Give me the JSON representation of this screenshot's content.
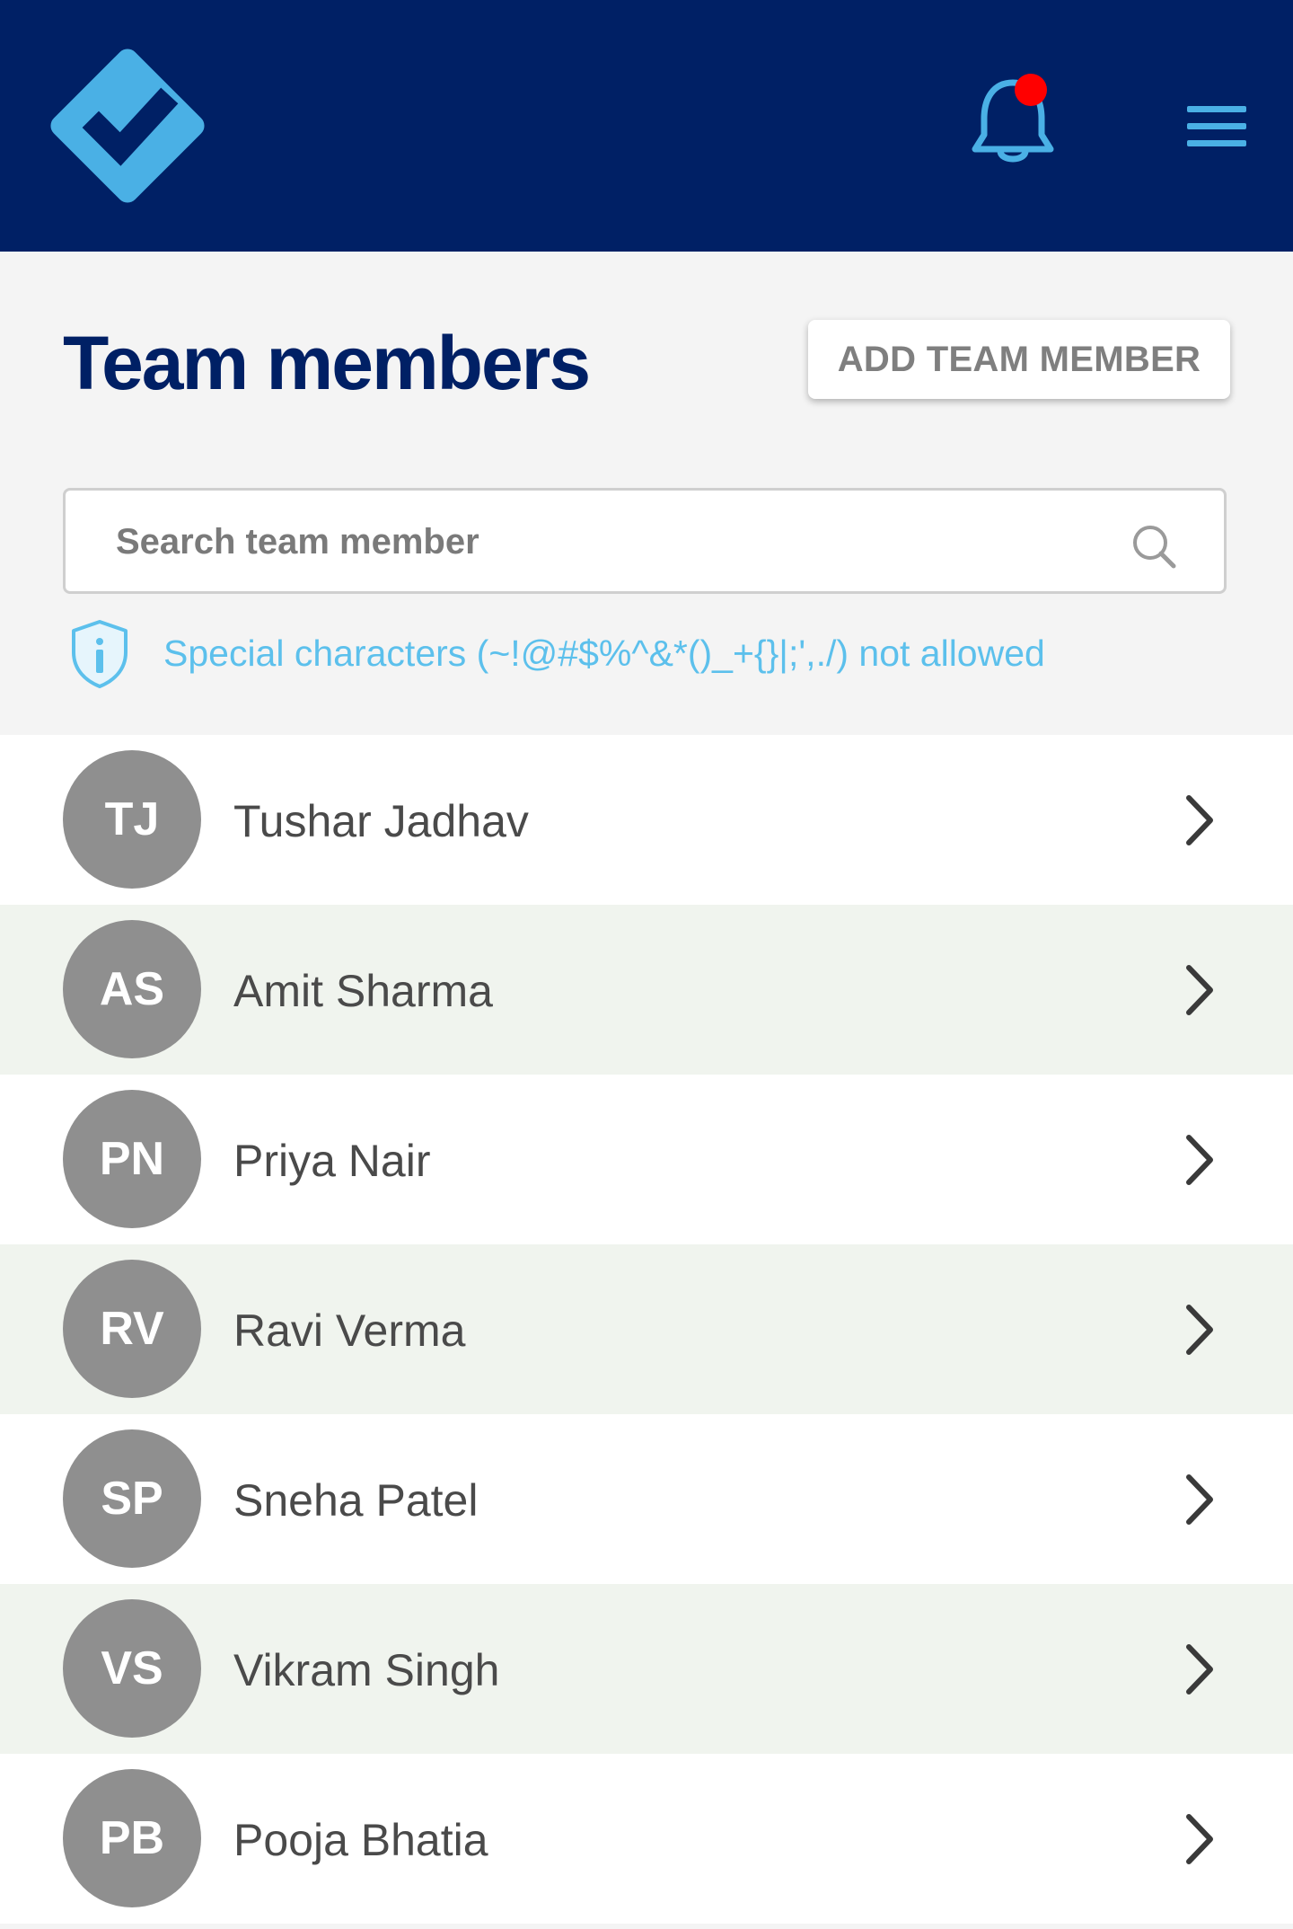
{
  "header": {
    "logo_icon": "checkmark-diamond-logo",
    "notification_icon": "bell-icon",
    "has_unread_notifications": true,
    "menu_icon": "hamburger-menu-icon",
    "background_color": "#002065",
    "accent_color": "#4ab0e5"
  },
  "page": {
    "title": "Team members",
    "add_button_label": "ADD TEAM MEMBER"
  },
  "search": {
    "placeholder": "Search team member",
    "value": "",
    "icon": "search-icon"
  },
  "info": {
    "icon": "shield-info-icon",
    "text": "Special characters (~!@#$%^&*()_+{}|;',./) not allowed"
  },
  "members": [
    {
      "initials": "TJ",
      "name": "Tushar Jadhav"
    },
    {
      "initials": "AS",
      "name": "Amit Sharma"
    },
    {
      "initials": "PN",
      "name": "Priya Nair"
    },
    {
      "initials": "RV",
      "name": "Ravi Verma"
    },
    {
      "initials": "SP",
      "name": "Sneha Patel"
    },
    {
      "initials": "VS",
      "name": "Vikram Singh"
    },
    {
      "initials": "PB",
      "name": "Pooja Bhatia"
    }
  ]
}
